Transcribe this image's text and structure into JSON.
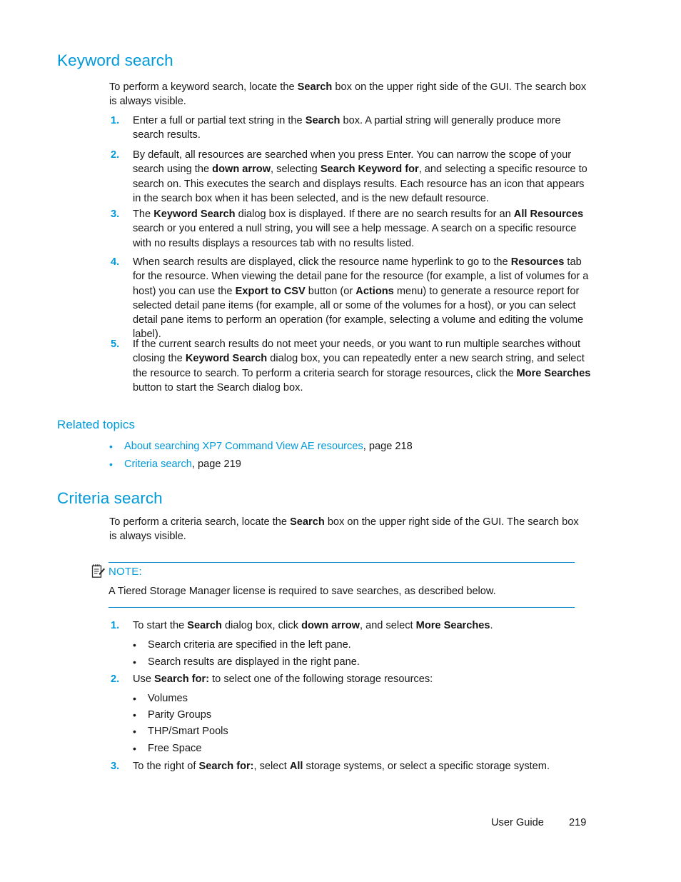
{
  "page": {
    "footer_label": "User Guide",
    "footer_page_number": "219"
  },
  "colors": {
    "heading_blue": "#0099da",
    "link_blue": "#0099da",
    "rule_blue": "#0082c8",
    "body_text": "#161616"
  },
  "sections": [
    {
      "id": "keyword-search",
      "heading": "Keyword search",
      "intro": {
        "line1_a": "To perform a keyword search, locate the ",
        "line1_b": "Search",
        "line1_c": " box on the upper right side of the GUI. The search",
        "line2": "box is always visible."
      },
      "steps": [
        {
          "number": "1.",
          "parts": [
            {
              "t": "Enter a full or partial text string in the ",
              "b": false
            },
            {
              "t": "Search",
              "b": true
            },
            {
              "t": " box. A partial string will generally produce more search results.",
              "b": false
            }
          ]
        },
        {
          "number": "2.",
          "parts": [
            {
              "t": "By default, all resources are searched when you press Enter. You can narrow the scope of your search using the ",
              "b": false
            },
            {
              "t": "down arrow",
              "b": true
            },
            {
              "t": ", selecting ",
              "b": false
            },
            {
              "t": "Search Keyword for",
              "b": true
            },
            {
              "t": ", and selecting a specific resource to search on. This executes the search and displays results. Each resource has an icon that appears in the search box when it has been selected, and is the new default resource.",
              "b": false
            }
          ]
        },
        {
          "number": "3.",
          "parts": [
            {
              "t": "The ",
              "b": false
            },
            {
              "t": "Keyword Search",
              "b": true
            },
            {
              "t": " dialog box is displayed. If there are no search results for an ",
              "b": false
            },
            {
              "t": "All Resources",
              "b": true
            },
            {
              "t": " search or you entered a null string, you will see a help message. A search on a specific resource with no results displays a resources tab with no results listed.",
              "b": false
            }
          ]
        },
        {
          "number": "4.",
          "parts": [
            {
              "t": "When search results are displayed, click the resource name hyperlink to go to the ",
              "b": false
            },
            {
              "t": "Resources",
              "b": true
            },
            {
              "t": " tab for the resource. When viewing the detail pane for the resource (for example, a list of volumes for a host) you can use the ",
              "b": false
            },
            {
              "t": "Export to CSV",
              "b": true
            },
            {
              "t": " button (or ",
              "b": false
            },
            {
              "t": "Actions",
              "b": true
            },
            {
              "t": " menu) to generate a resource report for selected detail pane items (for example, all or some of the volumes for a host), or you can select detail pane items to perform an operation (for example, selecting a volume and editing the volume label).",
              "b": false
            }
          ]
        },
        {
          "number": "5.",
          "parts": [
            {
              "t": "If the current search results do not meet your needs, or you want to run multiple searches without closing the ",
              "b": false
            },
            {
              "t": "Keyword Search",
              "b": true
            },
            {
              "t": " dialog box, you can repeatedly enter a new search string, and select the resource to search. To perform a criteria search for storage resources, click the ",
              "b": false
            },
            {
              "t": "More Searches",
              "b": true
            },
            {
              "t": " button to start the Search dialog box.",
              "b": false
            }
          ]
        }
      ]
    },
    {
      "id": "related-topics",
      "heading": "Related topics",
      "links": [
        {
          "bullet": "•",
          "link_text": "About searching XP7 Command View AE resources",
          "suffix": ", page 218"
        },
        {
          "bullet": "•",
          "link_text": "Criteria search",
          "suffix": ", page 219"
        }
      ]
    },
    {
      "id": "criteria-search",
      "heading": "Criteria search",
      "intro": {
        "line1_a": "To perform a criteria search, locate the ",
        "line1_b": "Search",
        "line1_c": " box on the upper right side of the GUI. The search",
        "line2": "box is always visible."
      },
      "note": {
        "icon_name": "note-pad-pencil-icon",
        "label": "NOTE:",
        "text": "A Tiered Storage Manager license is required to save searches, as described below."
      },
      "steps": [
        {
          "number": "1.",
          "parts": [
            {
              "t": "To start the ",
              "b": false
            },
            {
              "t": "Search",
              "b": true
            },
            {
              "t": " dialog box, click ",
              "b": false
            },
            {
              "t": "down arrow",
              "b": true
            },
            {
              "t": ", and select ",
              "b": false
            },
            {
              "t": "More Searches",
              "b": true
            },
            {
              "t": ".",
              "b": false
            }
          ]
        },
        {
          "number": "2.",
          "parts": [
            {
              "t": "Use ",
              "b": false
            },
            {
              "t": "Search for:",
              "b": true
            },
            {
              "t": " to select one of the following storage resources:",
              "b": false
            }
          ]
        },
        {
          "number": "3.",
          "parts": [
            {
              "t": "To the right of ",
              "b": false
            },
            {
              "t": "Search for:",
              "b": true
            },
            {
              "t": ", select ",
              "b": false
            },
            {
              "t": "All",
              "b": true
            },
            {
              "t": " storage systems, or select a specific storage system.",
              "b": false
            }
          ]
        }
      ],
      "step1_bullets": [
        {
          "bullet": "•",
          "text": "Search criteria are specified in the left pane."
        },
        {
          "bullet": "•",
          "text": "Search results are displayed in the right pane."
        }
      ],
      "step2_bullets": [
        {
          "bullet": "•",
          "text": "Volumes"
        },
        {
          "bullet": "•",
          "text": "Parity Groups"
        },
        {
          "bullet": "•",
          "text": "THP/Smart Pools"
        },
        {
          "bullet": "•",
          "text": "Free Space"
        }
      ]
    }
  ]
}
